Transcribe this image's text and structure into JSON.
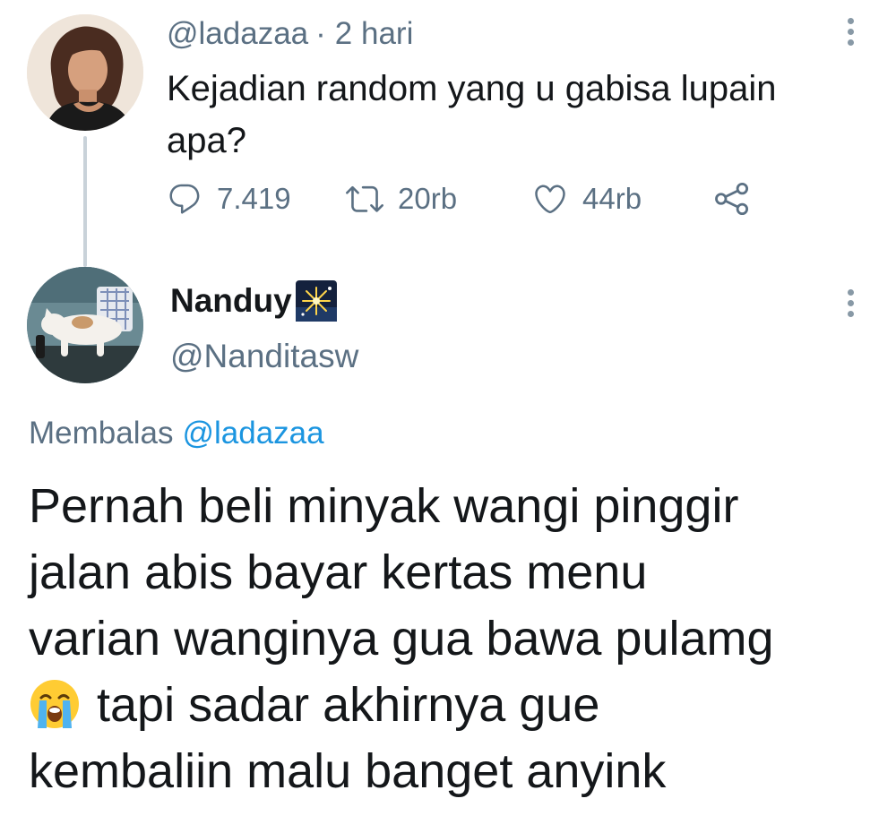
{
  "parent_tweet": {
    "handle": "@ladazaa",
    "separator": "·",
    "time": "2 hari",
    "text": "Kejadian random yang u gabisa lupain apa?",
    "stats": {
      "replies": "7.419",
      "retweets": "20rb",
      "likes": "44rb"
    }
  },
  "reply_tweet": {
    "display_name": "Nanduy",
    "handle": "@Nanditasw",
    "replying_prefix": "Membalas",
    "replying_mention": "@ladazaa",
    "body_lines": [
      "Pernah beli minyak wangi pinggir",
      "jalan abis bayar kertas menu",
      "varian wanginya gua bawa pulamg",
      "tapi sadar akhirnya gue",
      "kembaliin malu banget anyink"
    ]
  },
  "icons": {
    "reply": "reply-icon",
    "retweet": "retweet-icon",
    "like": "heart-icon",
    "share": "share-icon",
    "more": "more-vertical-icon",
    "name_emoji": "sparkler-emoji",
    "body_emoji": "loudly-crying-face-emoji"
  },
  "colors": {
    "text_primary": "#14171a",
    "text_secondary": "#5b7083",
    "mention": "#1b95e0",
    "thread_line": "#c9d2d9",
    "background": "#ffffff"
  }
}
